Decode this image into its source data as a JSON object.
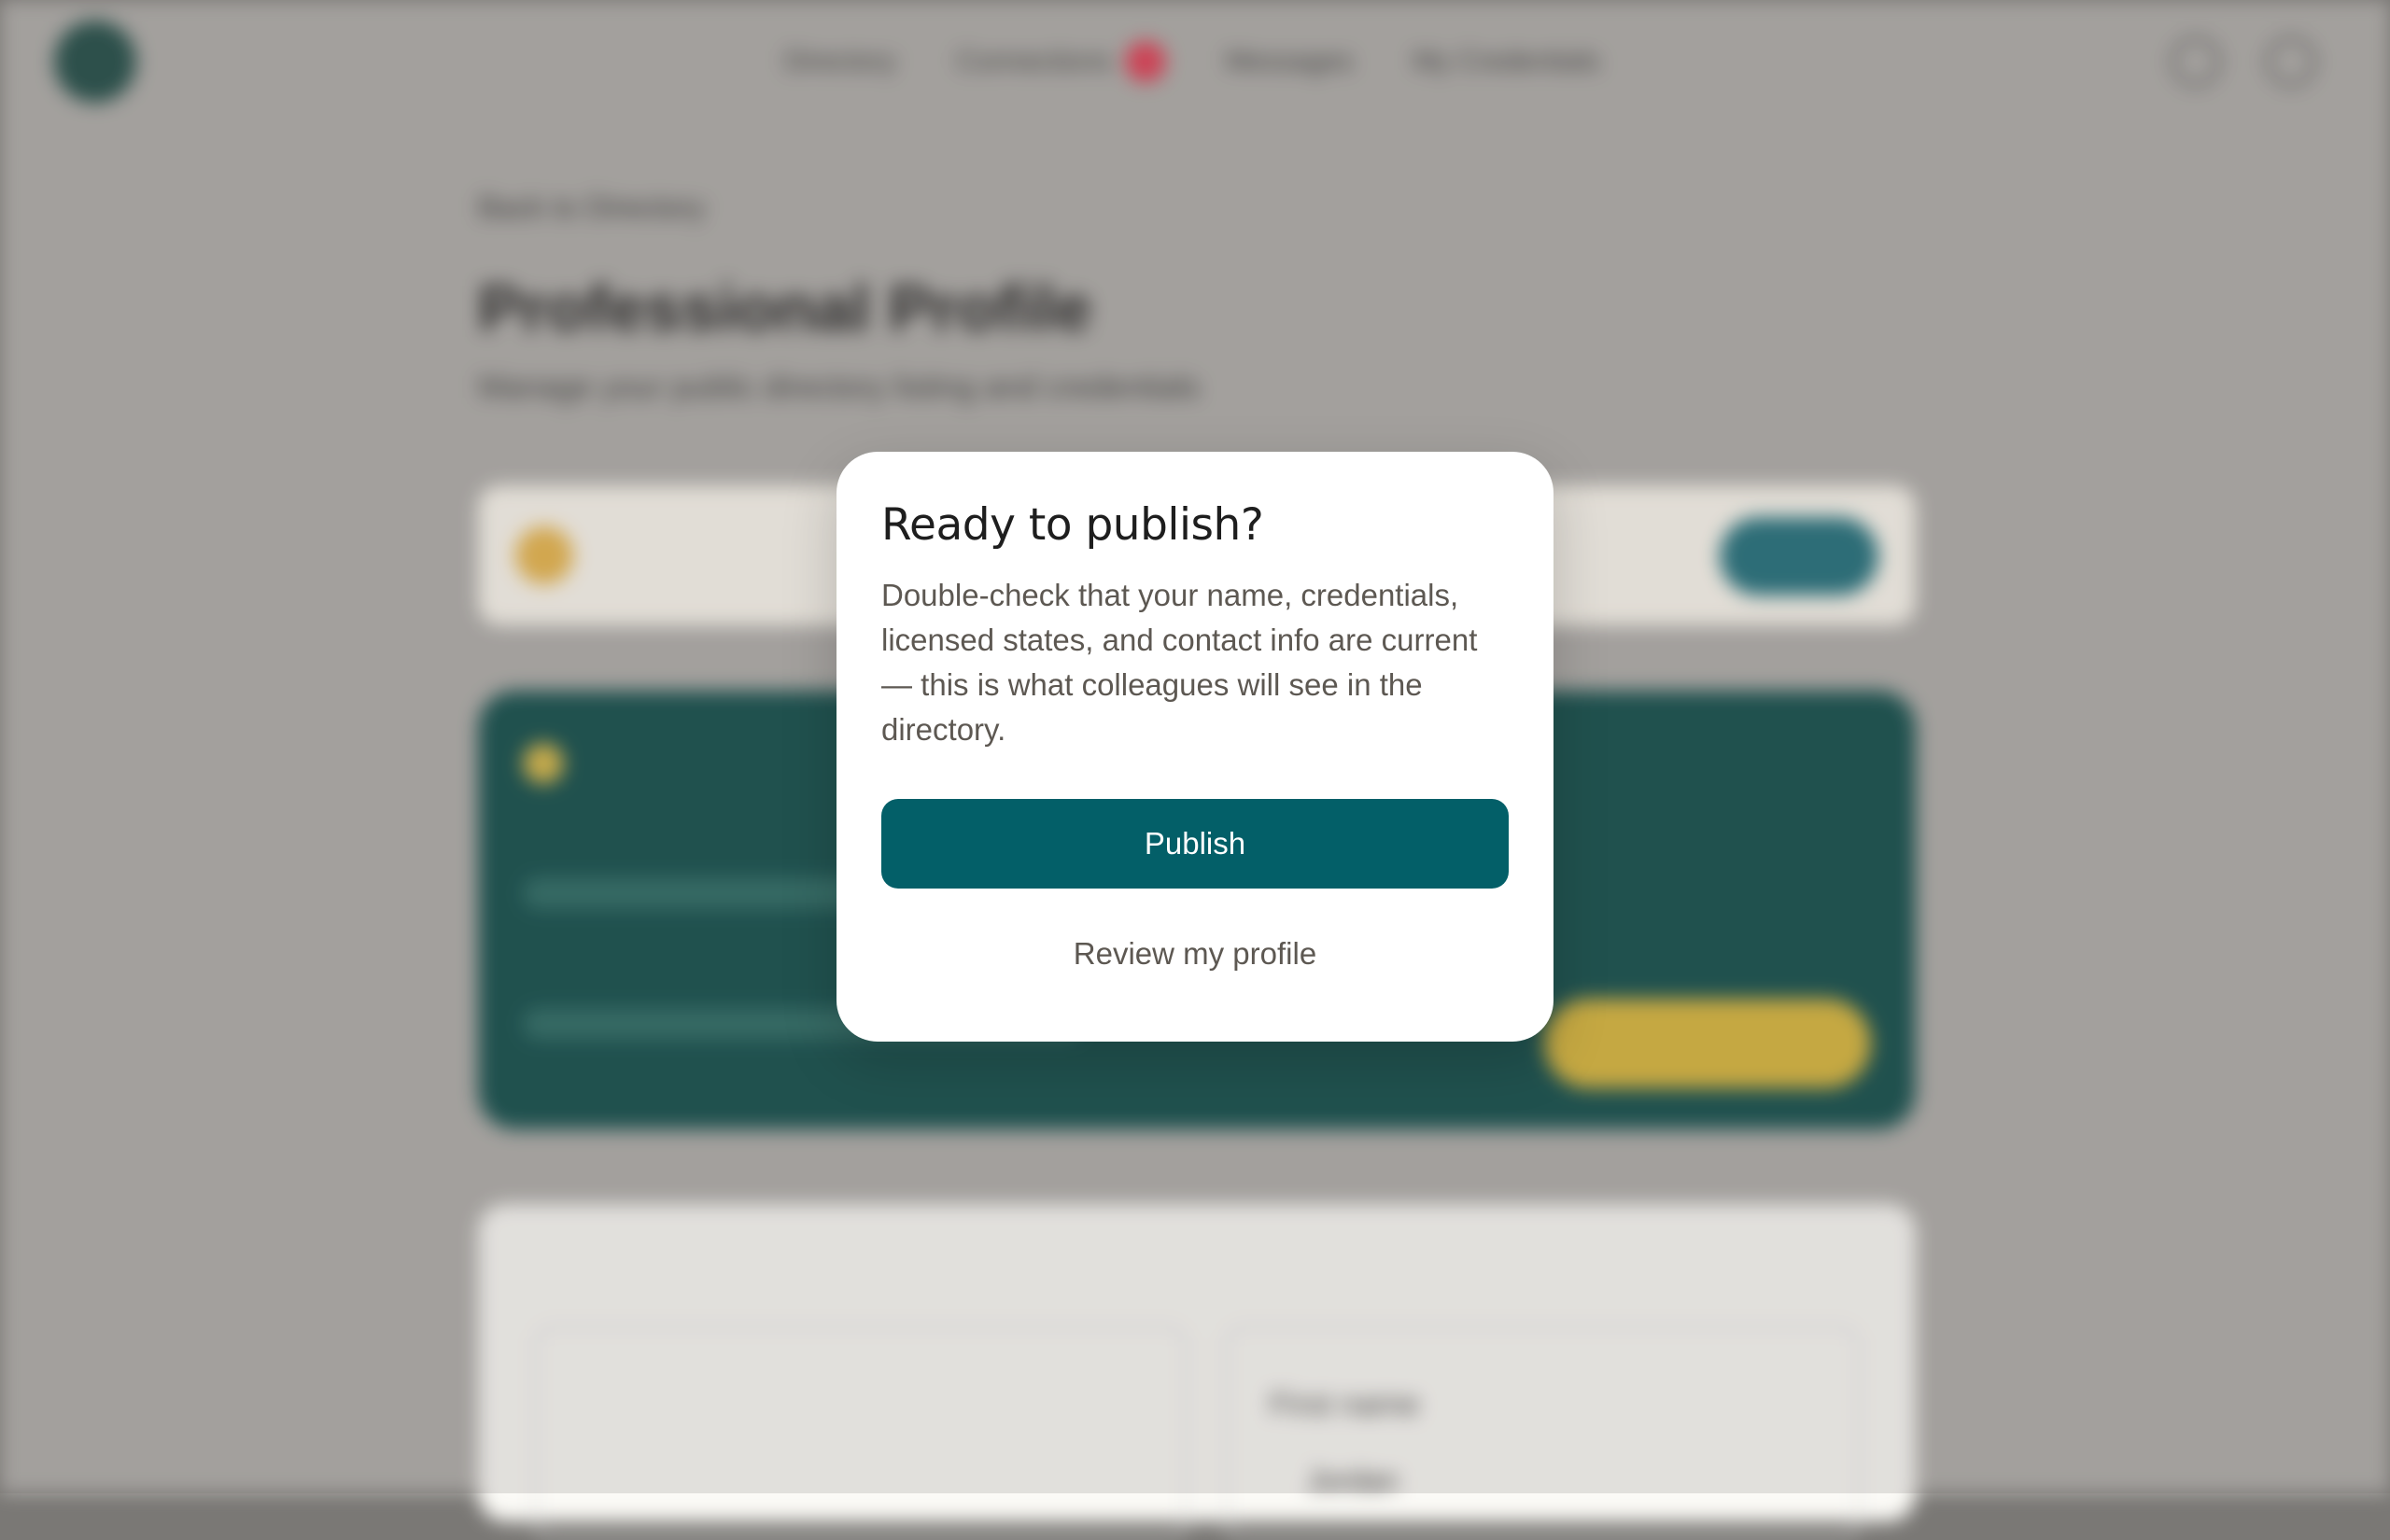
{
  "background": {
    "nav": {
      "items": [
        "Directory",
        "Connections",
        "Messages",
        "My Credentials"
      ],
      "badge_color": "#e13b52"
    },
    "breadcrumb": "Back to Directory",
    "page_title": "Professional Profile",
    "page_subtitle": "Manage your public directory listing and credentials",
    "field_label": "First name",
    "field_value": "Jordan"
  },
  "modal": {
    "title": "Ready to publish?",
    "body": "Double-check that your name, credentials, licensed states, and contact info are current — this is what colleagues will see in the directory.",
    "primary_label": "Publish",
    "secondary_label": "Review my profile",
    "primary_color": "#035f68"
  }
}
